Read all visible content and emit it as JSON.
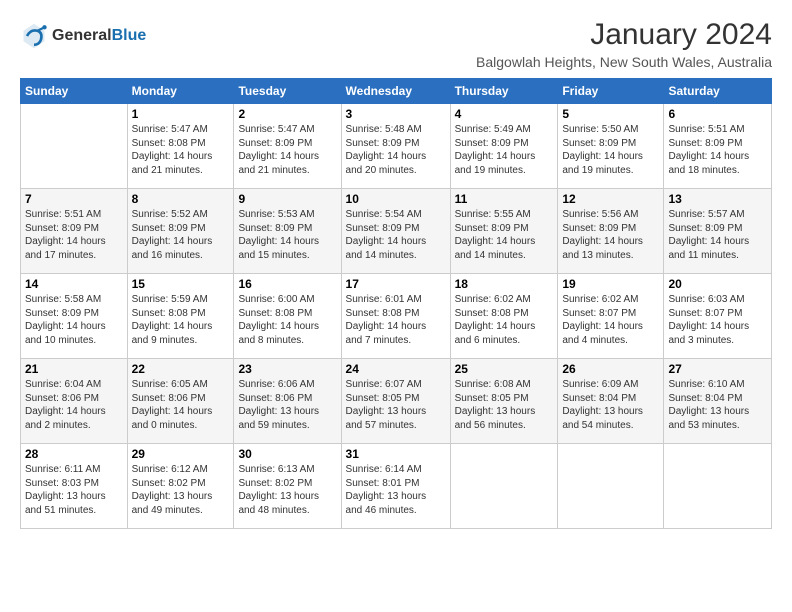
{
  "header": {
    "logo_line1": "General",
    "logo_line2": "Blue",
    "title": "January 2024",
    "subtitle": "Balgowlah Heights, New South Wales, Australia"
  },
  "calendar": {
    "headers": [
      "Sunday",
      "Monday",
      "Tuesday",
      "Wednesday",
      "Thursday",
      "Friday",
      "Saturday"
    ],
    "weeks": [
      [
        {
          "day": "",
          "info": ""
        },
        {
          "day": "1",
          "info": "Sunrise: 5:47 AM\nSunset: 8:08 PM\nDaylight: 14 hours\nand 21 minutes."
        },
        {
          "day": "2",
          "info": "Sunrise: 5:47 AM\nSunset: 8:09 PM\nDaylight: 14 hours\nand 21 minutes."
        },
        {
          "day": "3",
          "info": "Sunrise: 5:48 AM\nSunset: 8:09 PM\nDaylight: 14 hours\nand 20 minutes."
        },
        {
          "day": "4",
          "info": "Sunrise: 5:49 AM\nSunset: 8:09 PM\nDaylight: 14 hours\nand 19 minutes."
        },
        {
          "day": "5",
          "info": "Sunrise: 5:50 AM\nSunset: 8:09 PM\nDaylight: 14 hours\nand 19 minutes."
        },
        {
          "day": "6",
          "info": "Sunrise: 5:51 AM\nSunset: 8:09 PM\nDaylight: 14 hours\nand 18 minutes."
        }
      ],
      [
        {
          "day": "7",
          "info": "Sunrise: 5:51 AM\nSunset: 8:09 PM\nDaylight: 14 hours\nand 17 minutes."
        },
        {
          "day": "8",
          "info": "Sunrise: 5:52 AM\nSunset: 8:09 PM\nDaylight: 14 hours\nand 16 minutes."
        },
        {
          "day": "9",
          "info": "Sunrise: 5:53 AM\nSunset: 8:09 PM\nDaylight: 14 hours\nand 15 minutes."
        },
        {
          "day": "10",
          "info": "Sunrise: 5:54 AM\nSunset: 8:09 PM\nDaylight: 14 hours\nand 14 minutes."
        },
        {
          "day": "11",
          "info": "Sunrise: 5:55 AM\nSunset: 8:09 PM\nDaylight: 14 hours\nand 14 minutes."
        },
        {
          "day": "12",
          "info": "Sunrise: 5:56 AM\nSunset: 8:09 PM\nDaylight: 14 hours\nand 13 minutes."
        },
        {
          "day": "13",
          "info": "Sunrise: 5:57 AM\nSunset: 8:09 PM\nDaylight: 14 hours\nand 11 minutes."
        }
      ],
      [
        {
          "day": "14",
          "info": "Sunrise: 5:58 AM\nSunset: 8:09 PM\nDaylight: 14 hours\nand 10 minutes."
        },
        {
          "day": "15",
          "info": "Sunrise: 5:59 AM\nSunset: 8:08 PM\nDaylight: 14 hours\nand 9 minutes."
        },
        {
          "day": "16",
          "info": "Sunrise: 6:00 AM\nSunset: 8:08 PM\nDaylight: 14 hours\nand 8 minutes."
        },
        {
          "day": "17",
          "info": "Sunrise: 6:01 AM\nSunset: 8:08 PM\nDaylight: 14 hours\nand 7 minutes."
        },
        {
          "day": "18",
          "info": "Sunrise: 6:02 AM\nSunset: 8:08 PM\nDaylight: 14 hours\nand 6 minutes."
        },
        {
          "day": "19",
          "info": "Sunrise: 6:02 AM\nSunset: 8:07 PM\nDaylight: 14 hours\nand 4 minutes."
        },
        {
          "day": "20",
          "info": "Sunrise: 6:03 AM\nSunset: 8:07 PM\nDaylight: 14 hours\nand 3 minutes."
        }
      ],
      [
        {
          "day": "21",
          "info": "Sunrise: 6:04 AM\nSunset: 8:06 PM\nDaylight: 14 hours\nand 2 minutes."
        },
        {
          "day": "22",
          "info": "Sunrise: 6:05 AM\nSunset: 8:06 PM\nDaylight: 14 hours\nand 0 minutes."
        },
        {
          "day": "23",
          "info": "Sunrise: 6:06 AM\nSunset: 8:06 PM\nDaylight: 13 hours\nand 59 minutes."
        },
        {
          "day": "24",
          "info": "Sunrise: 6:07 AM\nSunset: 8:05 PM\nDaylight: 13 hours\nand 57 minutes."
        },
        {
          "day": "25",
          "info": "Sunrise: 6:08 AM\nSunset: 8:05 PM\nDaylight: 13 hours\nand 56 minutes."
        },
        {
          "day": "26",
          "info": "Sunrise: 6:09 AM\nSunset: 8:04 PM\nDaylight: 13 hours\nand 54 minutes."
        },
        {
          "day": "27",
          "info": "Sunrise: 6:10 AM\nSunset: 8:04 PM\nDaylight: 13 hours\nand 53 minutes."
        }
      ],
      [
        {
          "day": "28",
          "info": "Sunrise: 6:11 AM\nSunset: 8:03 PM\nDaylight: 13 hours\nand 51 minutes."
        },
        {
          "day": "29",
          "info": "Sunrise: 6:12 AM\nSunset: 8:02 PM\nDaylight: 13 hours\nand 49 minutes."
        },
        {
          "day": "30",
          "info": "Sunrise: 6:13 AM\nSunset: 8:02 PM\nDaylight: 13 hours\nand 48 minutes."
        },
        {
          "day": "31",
          "info": "Sunrise: 6:14 AM\nSunset: 8:01 PM\nDaylight: 13 hours\nand 46 minutes."
        },
        {
          "day": "",
          "info": ""
        },
        {
          "day": "",
          "info": ""
        },
        {
          "day": "",
          "info": ""
        }
      ]
    ]
  }
}
